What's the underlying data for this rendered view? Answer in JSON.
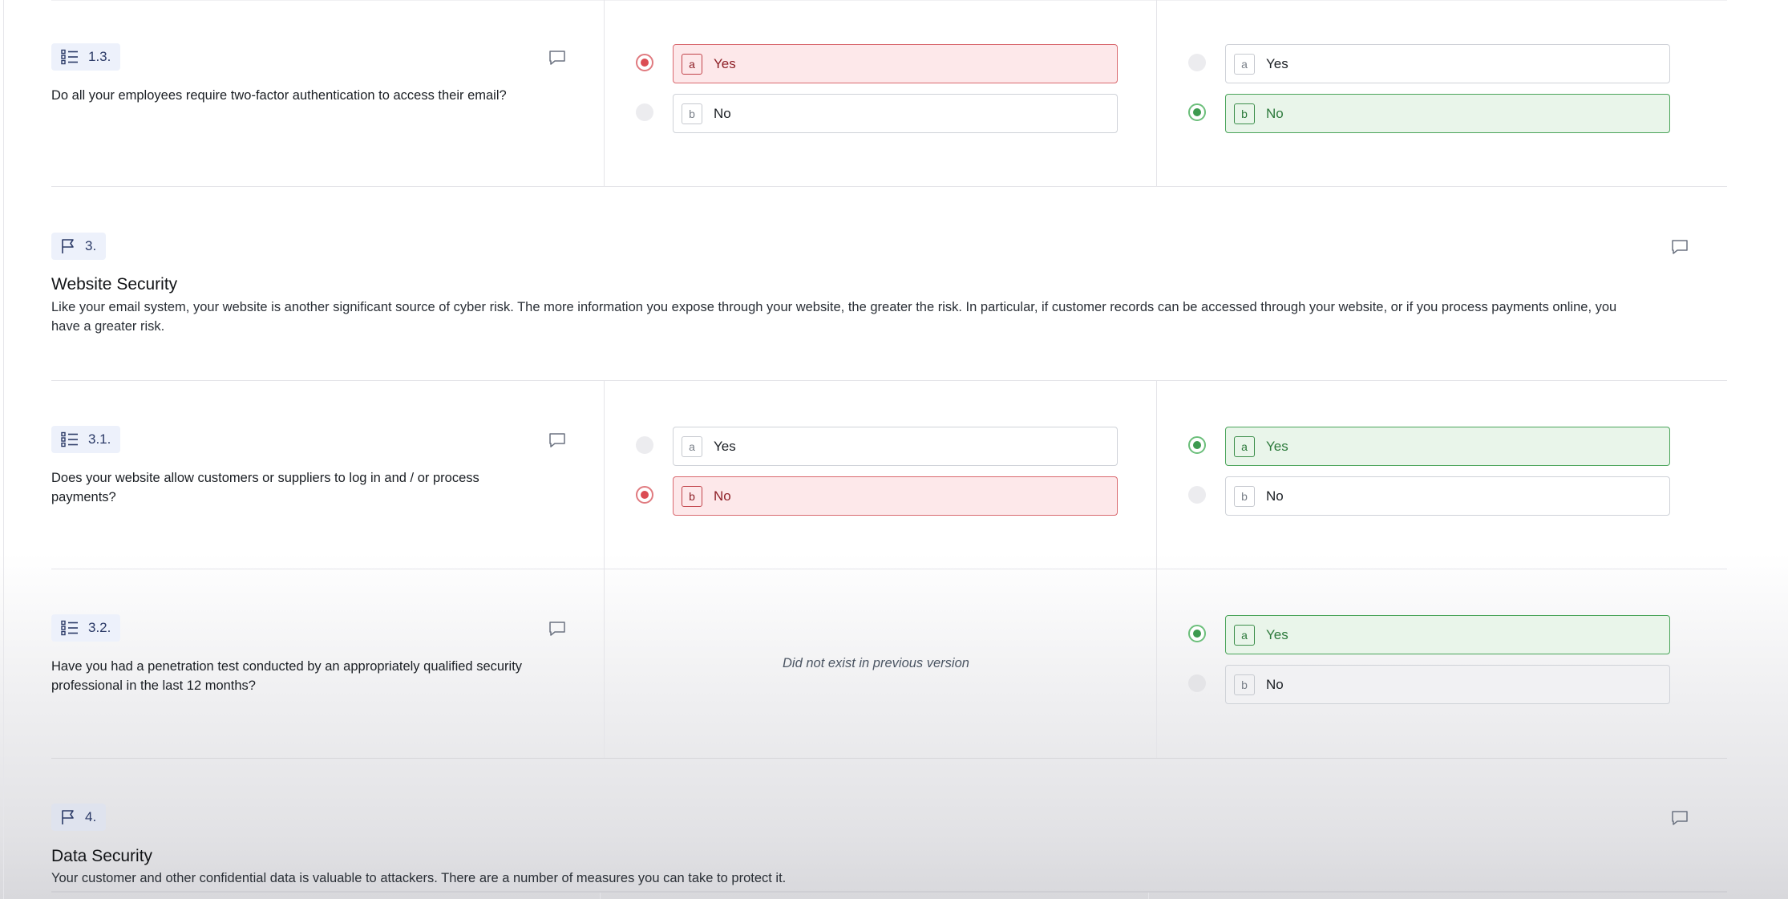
{
  "questions": {
    "q1_3": {
      "number": "1.3.",
      "text": "Do all your employees require two-factor authentication to access their email?",
      "previous": [
        {
          "key": "a",
          "label": "Yes",
          "state": "removed"
        },
        {
          "key": "b",
          "label": "No",
          "state": "none"
        }
      ],
      "current": [
        {
          "key": "a",
          "label": "Yes",
          "state": "none"
        },
        {
          "key": "b",
          "label": "No",
          "state": "added"
        }
      ]
    },
    "q3_1": {
      "number": "3.1.",
      "text": "Does your website allow customers or suppliers to log in and / or process payments?",
      "previous": [
        {
          "key": "a",
          "label": "Yes",
          "state": "none"
        },
        {
          "key": "b",
          "label": "No",
          "state": "removed"
        }
      ],
      "current": [
        {
          "key": "a",
          "label": "Yes",
          "state": "added"
        },
        {
          "key": "b",
          "label": "No",
          "state": "none"
        }
      ]
    },
    "q3_2": {
      "number": "3.2.",
      "text": "Have you had a penetration test conducted by an appropriately qualified security professional in the last 12 months?",
      "previous_note": "Did not exist in previous version",
      "current": [
        {
          "key": "a",
          "label": "Yes",
          "state": "added"
        },
        {
          "key": "b",
          "label": "No",
          "state": "none"
        }
      ]
    }
  },
  "sections": {
    "s3": {
      "number": "3.",
      "title": "Website Security",
      "description": "Like your email system, your website is another significant source of cyber risk. The more information you expose through your website, the greater the risk. In particular, if customer records can be accessed through your website, or if you process payments online, you have a greater risk."
    },
    "s4": {
      "number": "4.",
      "title": "Data Security",
      "description": "Your customer and other confidential data is valuable to attackers. There are a number of measures you can take to protect it."
    }
  },
  "icons": {
    "question": "list-icon",
    "section": "flag-icon",
    "comment": "comment-icon"
  },
  "colors": {
    "removed_bg": "#fde8ea",
    "removed_border": "#d9696f",
    "added_bg": "#e9f5ea",
    "added_border": "#4aa45a",
    "badge_bg": "#edf1fb"
  }
}
